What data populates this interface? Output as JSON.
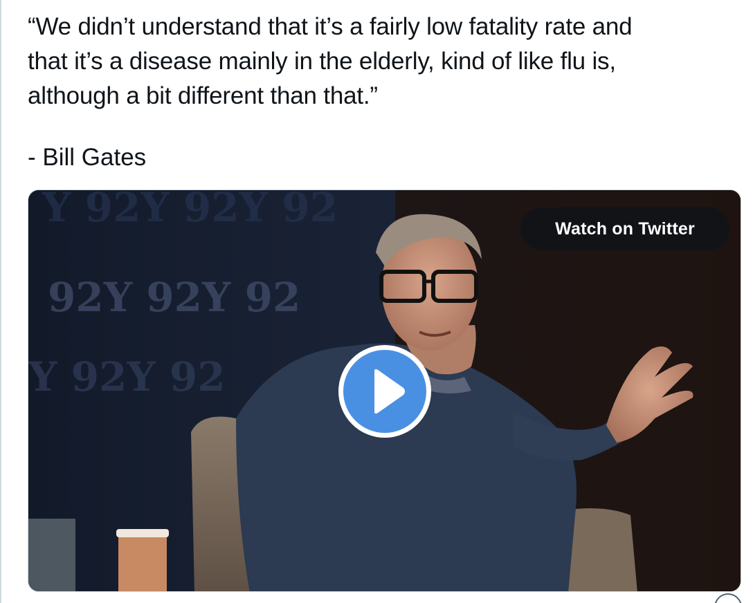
{
  "tweet": {
    "quote_lines": [
      "“We didn’t understand that it’s a fairly low fatality rate and",
      "that it’s a disease mainly in the elderly, kind of like flu is,",
      "although a bit different than that.”"
    ],
    "attribution": "- Bill Gates"
  },
  "video": {
    "watch_label": "Watch on Twitter",
    "backdrop_logo": "92Y",
    "play_icon": "play-icon",
    "accent_color": "#4a90e2"
  },
  "colors": {
    "text": "#0f1419",
    "border": "#cfd9de",
    "watch_button_bg": "#0f1419"
  }
}
